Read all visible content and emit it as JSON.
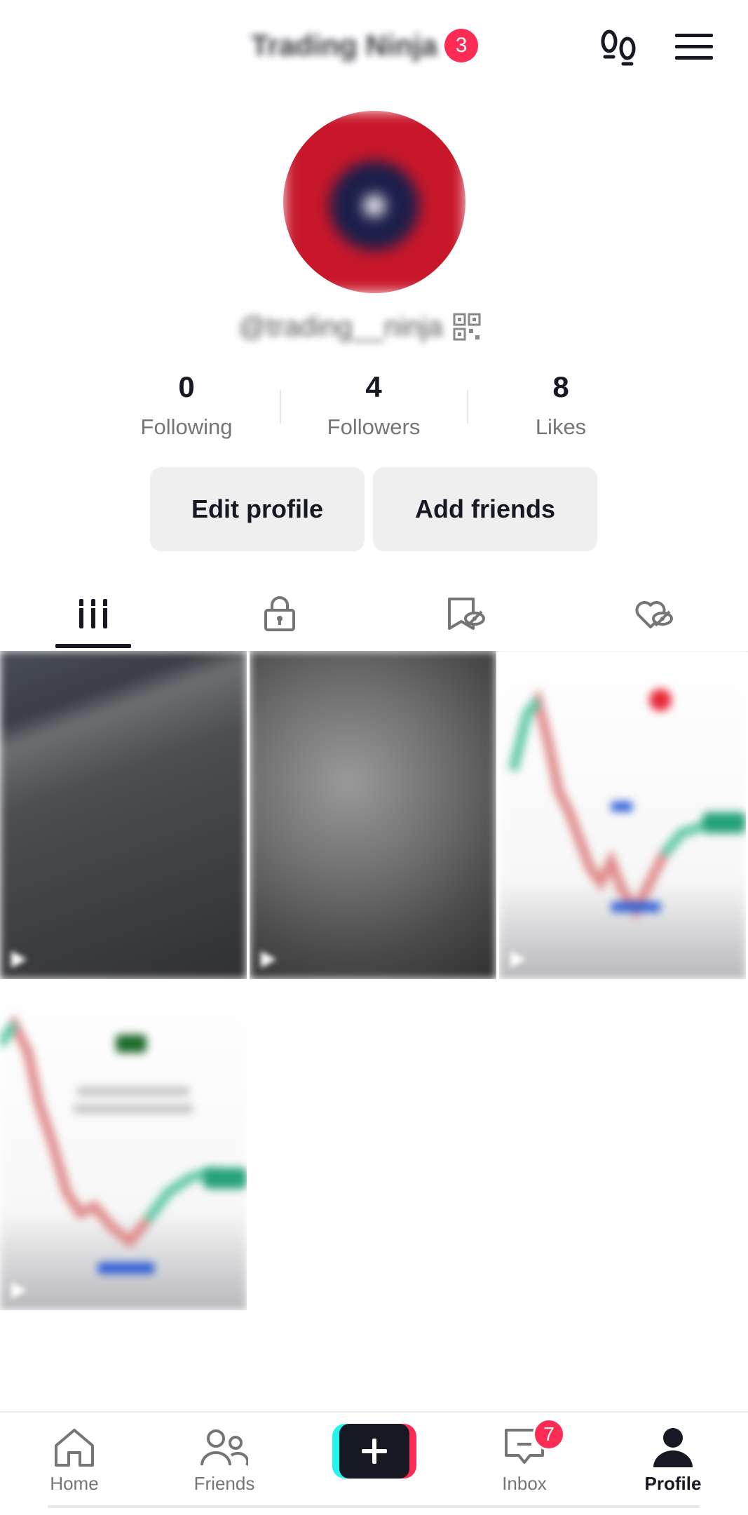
{
  "header": {
    "title": "Trading Ninja",
    "title_badge": "3",
    "footprint_icon": "footprints-icon",
    "menu_icon": "hamburger-menu-icon"
  },
  "profile": {
    "handle": "@trading__ninja",
    "avatar_colors": [
      "#c8172a",
      "#1b1e4a"
    ],
    "qr_icon": "qr-code-icon"
  },
  "stats": [
    {
      "value": "0",
      "label": "Following"
    },
    {
      "value": "4",
      "label": "Followers"
    },
    {
      "value": "8",
      "label": "Likes"
    }
  ],
  "actions": {
    "edit_profile": "Edit profile",
    "add_friends": "Add friends"
  },
  "tabs": [
    {
      "icon": "videos-grid-icon",
      "active": true
    },
    {
      "icon": "lock-icon",
      "active": false
    },
    {
      "icon": "bookmark-hidden-icon",
      "active": false
    },
    {
      "icon": "liked-hidden-icon",
      "active": false
    }
  ],
  "videos": [
    {
      "type": "dark-photo"
    },
    {
      "type": "gray-texture"
    },
    {
      "type": "trading-chart"
    },
    {
      "type": "trading-chart"
    }
  ],
  "nav": {
    "home": "Home",
    "friends": "Friends",
    "create_icon": "plus-icon",
    "inbox": "Inbox",
    "inbox_badge": "7",
    "profile": "Profile"
  },
  "colors": {
    "accent": "#fe2c55",
    "cyan": "#25f4ee",
    "text": "#161823",
    "muted": "#757575",
    "button_bg": "#efefef"
  }
}
